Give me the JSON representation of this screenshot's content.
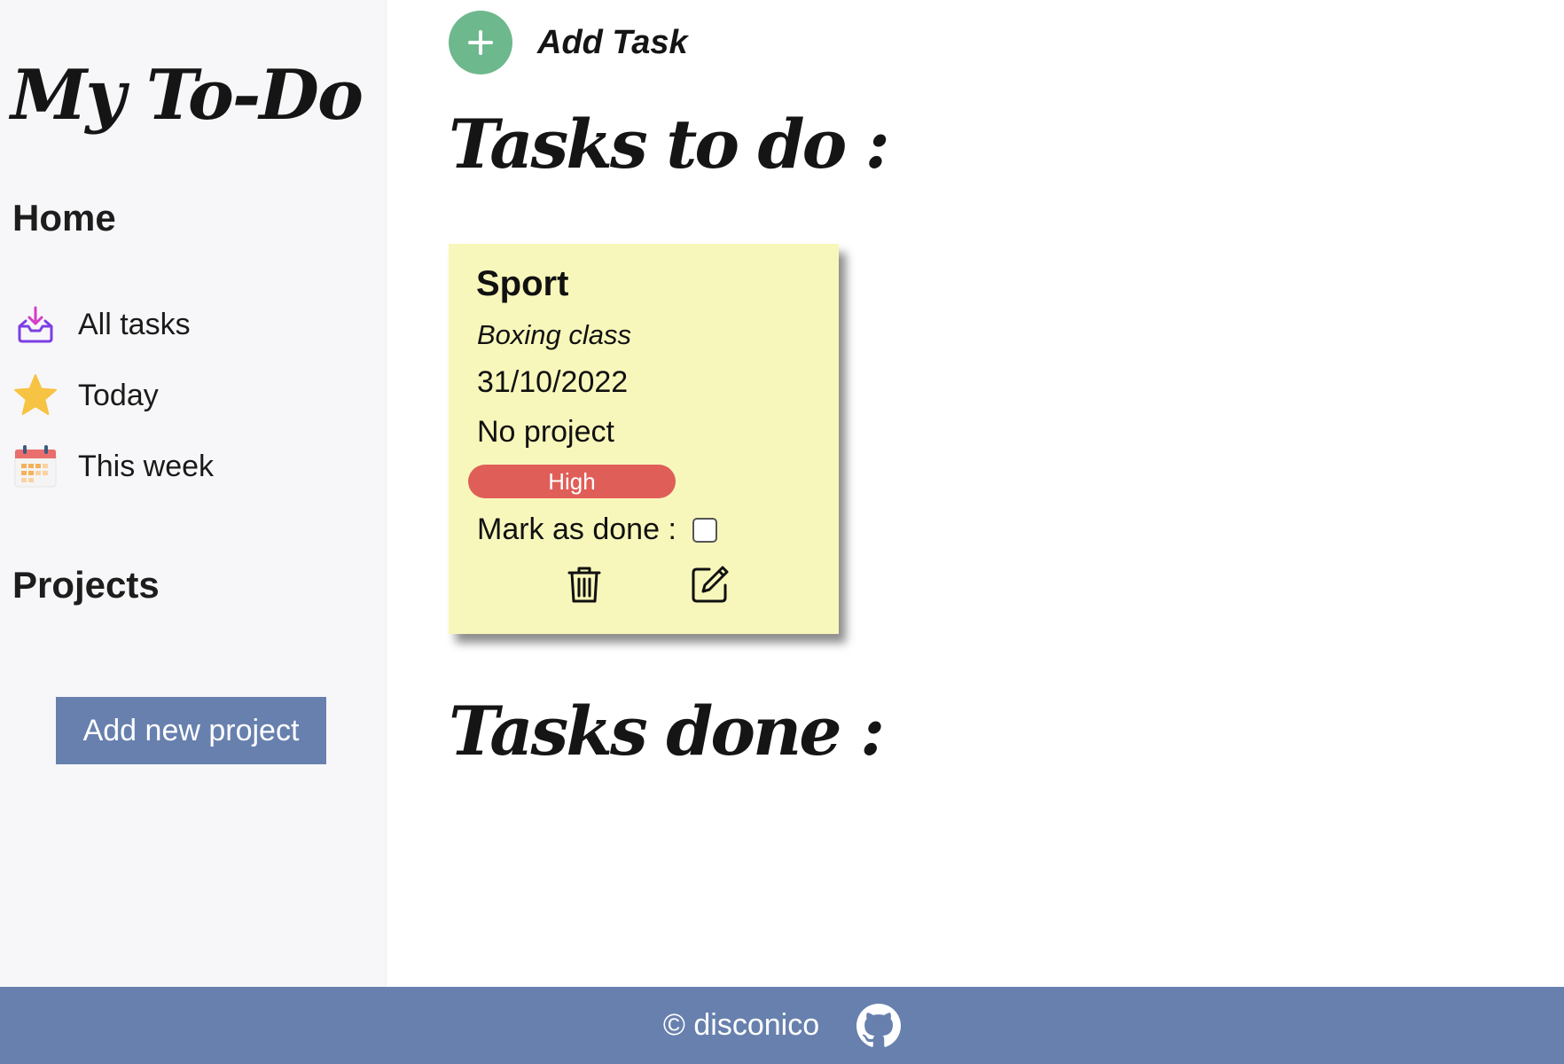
{
  "app": {
    "logo": "My To-Do"
  },
  "sidebar": {
    "home_title": "Home",
    "items": [
      {
        "label": "All tasks",
        "icon": "inbox-icon"
      },
      {
        "label": "Today",
        "icon": "star-icon"
      },
      {
        "label": "This week",
        "icon": "calendar-icon"
      }
    ],
    "projects_title": "Projects",
    "add_project_label": "Add new project"
  },
  "main": {
    "add_task_label": "Add Task",
    "todo_title": "Tasks to do :",
    "done_title": "Tasks done :",
    "tasks": [
      {
        "title": "Sport",
        "description": "Boxing class",
        "date": "31/10/2022",
        "project": "No project",
        "priority": "High",
        "done_label": "Mark as done :",
        "done": false
      }
    ]
  },
  "footer": {
    "text": "© disconico",
    "icon": "github-icon"
  },
  "colors": {
    "accent": "#6780ae",
    "add_button": "#6db88d",
    "card": "#f8f7bb",
    "priority_high": "#e05e58",
    "star": "#f6c343",
    "inbox": "#7b3fe4"
  }
}
